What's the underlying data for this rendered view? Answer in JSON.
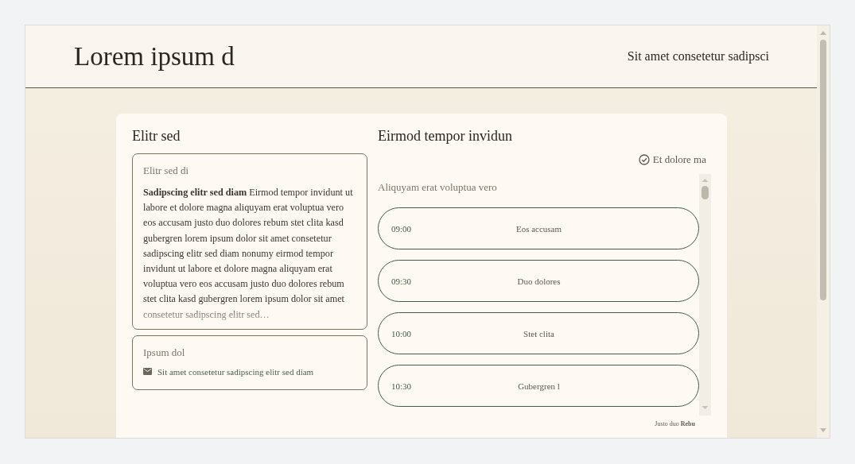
{
  "header": {
    "title": "Lorem ipsum d",
    "link": "Sit amet consetetur sadipsci"
  },
  "left": {
    "heading": "Elitr sed",
    "note": {
      "label": "Elitr sed di",
      "text": "**Sadipscing elitr sed diam** Eirmod tempor invidunt ut labore et dolore magna aliquyam erat voluptua vero eos accusam justo duo dolores rebum stet clita kasd gubergren lorem ipsum dolor sit amet consetetur sadipscing elitr sed diam nonumy eirmod tempor invidunt ut labore et dolore magna aliquyam erat voluptua vero eos accusam justo duo dolores rebum stet clita kasd gubergren lorem ipsum dolor sit amet consetetur sadipscing elitr sed…"
    },
    "contact": {
      "label": "Ipsum dol",
      "email": "Sit amet consetetur sadipscing elitr sed diam"
    }
  },
  "right": {
    "heading": "Eirmod tempor invidun",
    "status": "Et dolore ma",
    "subtitle": "Aliquyam erat voluptua vero",
    "slots": [
      {
        "time": "09:00",
        "label": "Eos accusam"
      },
      {
        "time": "09:30",
        "label": "Duo dolores"
      },
      {
        "time": "10:00",
        "label": "Stet clita"
      },
      {
        "time": "10:30",
        "label": "Gubergren l"
      }
    ],
    "footer": "Justo duo **Rebu**"
  }
}
